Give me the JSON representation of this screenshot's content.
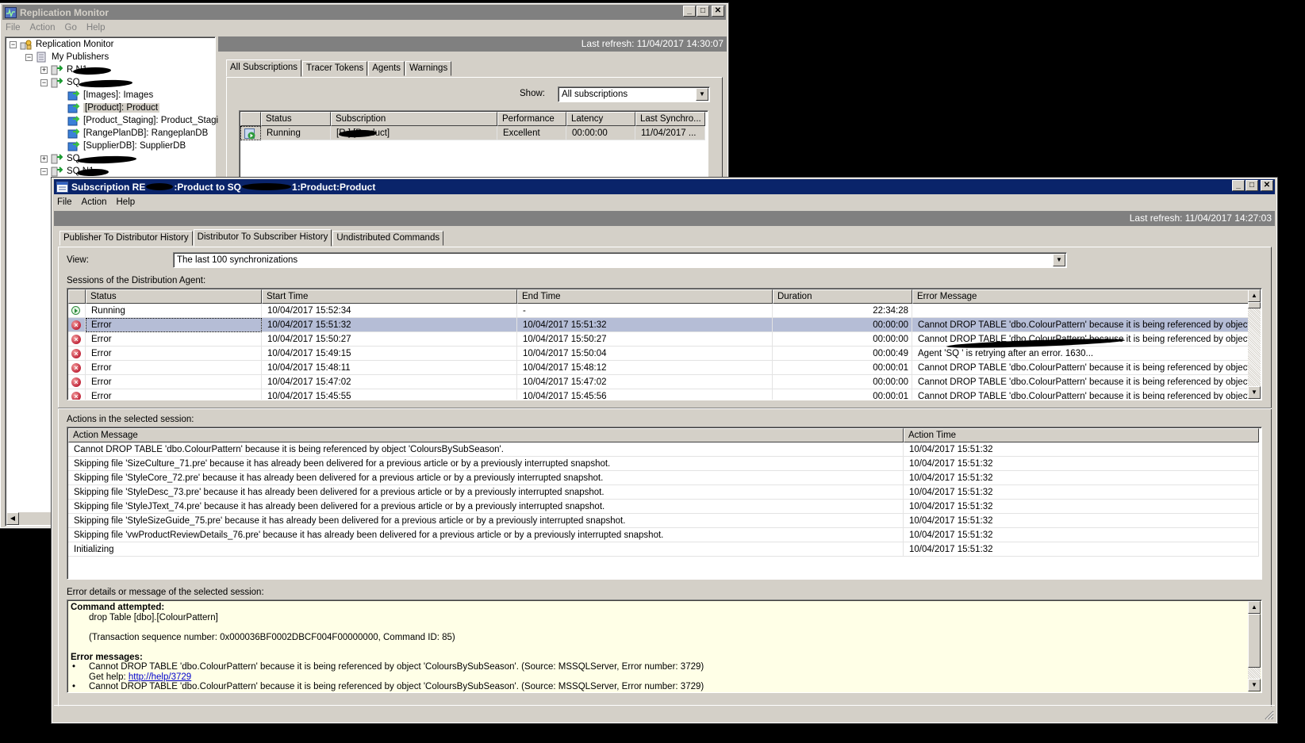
{
  "desktop": {
    "corner_text": "..."
  },
  "monitor_window": {
    "title": "Replication Monitor",
    "menu": [
      "File",
      "Action",
      "Go",
      "Help"
    ],
    "last_refresh": "Last refresh: 11/04/2017 14:30:07",
    "tree": {
      "root": "Replication Monitor",
      "publishers_group": "My Publishers",
      "publishers": [
        {
          "label": "R      N1",
          "expanded": false
        },
        {
          "label": "SQ",
          "expanded": true,
          "publications": [
            "[Images]: Images",
            "[Product]: Product",
            "[Product_Staging]: Product_Staging",
            "[RangePlanDB]: RangeplanDB",
            "[SupplierDB]: SupplierDB"
          ]
        },
        {
          "label": "SQ",
          "expanded": false
        },
        {
          "label": "SQ       N1",
          "expanded": true
        }
      ],
      "selected": "[Product]: Product"
    },
    "tabs": [
      "All Subscriptions",
      "Tracer Tokens",
      "Agents",
      "Warnings"
    ],
    "active_tab": "All Subscriptions",
    "show_label": "Show:",
    "show_value": "All subscriptions",
    "grid": {
      "columns": [
        "",
        "Status",
        "Subscription",
        "Performance",
        "Latency",
        "Last Synchro..."
      ],
      "rows": [
        {
          "status": "Running",
          "subscription": "[R        ].[Product]",
          "performance": "Excellent",
          "latency": "00:00:00",
          "last_sync": "11/04/2017 ..."
        }
      ]
    }
  },
  "subscription_window": {
    "title_parts": [
      "Subscription RE",
      ":Product to SQ",
      "1:Product:Product"
    ],
    "menu": [
      "File",
      "Action",
      "Help"
    ],
    "last_refresh": "Last refresh: 11/04/2017 14:27:03",
    "tabs": [
      "Publisher To Distributor History",
      "Distributor To Subscriber History",
      "Undistributed Commands"
    ],
    "active_tab": "Distributor To Subscriber History",
    "view_label": "View:",
    "view_value": "The last 100 synchronizations",
    "sessions_label": "Sessions of the Distribution Agent:",
    "sessions": {
      "columns": [
        "",
        "Status",
        "Start Time",
        "End Time",
        "Duration",
        "Error Message"
      ],
      "rows": [
        {
          "icon": "running",
          "status": "Running",
          "start": "10/04/2017 15:52:34",
          "end": "-",
          "duration": "22:34:28",
          "message": ""
        },
        {
          "icon": "error",
          "status": "Error",
          "start": "10/04/2017 15:51:32",
          "end": "10/04/2017 15:51:32",
          "duration": "00:00:00",
          "message": "Cannot DROP TABLE 'dbo.ColourPattern' because it is being referenced by object 'C...",
          "selected": true
        },
        {
          "icon": "error",
          "status": "Error",
          "start": "10/04/2017 15:50:27",
          "end": "10/04/2017 15:50:27",
          "duration": "00:00:00",
          "message": "Cannot DROP TABLE 'dbo.ColourPattern' because it is being referenced by object 'C..."
        },
        {
          "icon": "error",
          "status": "Error",
          "start": "10/04/2017 15:49:15",
          "end": "10/04/2017 15:50:04",
          "duration": "00:00:49",
          "message": "Agent 'SQ                                   ' is retrying after an error. 1630..."
        },
        {
          "icon": "error",
          "status": "Error",
          "start": "10/04/2017 15:48:11",
          "end": "10/04/2017 15:48:12",
          "duration": "00:00:01",
          "message": "Cannot DROP TABLE 'dbo.ColourPattern' because it is being referenced by object 'C..."
        },
        {
          "icon": "error",
          "status": "Error",
          "start": "10/04/2017 15:47:02",
          "end": "10/04/2017 15:47:02",
          "duration": "00:00:00",
          "message": "Cannot DROP TABLE 'dbo.ColourPattern' because it is being referenced by object 'C..."
        },
        {
          "icon": "error",
          "status": "Error",
          "start": "10/04/2017 15:45:55",
          "end": "10/04/2017 15:45:56",
          "duration": "00:00:01",
          "message": "Cannot DROP TABLE 'dbo.ColourPattern' because it is being referenced by object 'C..."
        }
      ]
    },
    "actions_label": "Actions in the selected session:",
    "actions": {
      "columns": [
        "Action Message",
        "Action Time"
      ],
      "rows": [
        {
          "message": "Cannot DROP TABLE 'dbo.ColourPattern' because it is being referenced by object 'ColoursBySubSeason'.",
          "time": "10/04/2017 15:51:32"
        },
        {
          "message": "Skipping file 'SizeCulture_71.pre' because it has already been delivered for a previous article or by a previously interrupted snapshot.",
          "time": "10/04/2017 15:51:32"
        },
        {
          "message": "Skipping file 'StyleCore_72.pre' because it has already been delivered for a previous article or by a previously interrupted snapshot.",
          "time": "10/04/2017 15:51:32"
        },
        {
          "message": "Skipping file 'StyleDesc_73.pre' because it has already been delivered for a previous article or by a previously interrupted snapshot.",
          "time": "10/04/2017 15:51:32"
        },
        {
          "message": "Skipping file 'StyleJText_74.pre' because it has already been delivered for a previous article or by a previously interrupted snapshot.",
          "time": "10/04/2017 15:51:32"
        },
        {
          "message": "Skipping file 'StyleSizeGuide_75.pre' because it has already been delivered for a previous article or by a previously interrupted snapshot.",
          "time": "10/04/2017 15:51:32"
        },
        {
          "message": "Skipping file 'vwProductReviewDetails_76.pre' because it has already been delivered for a previous article or by a previously interrupted snapshot.",
          "time": "10/04/2017 15:51:32"
        },
        {
          "message": "Initializing",
          "time": "10/04/2017 15:51:32"
        }
      ]
    },
    "error_label": "Error details or message of the selected session:",
    "error_details": {
      "command_heading": "Command attempted:",
      "command": "drop Table [dbo].[ColourPattern]",
      "transaction": "(Transaction sequence number: 0x000036BF0002DBCF004F00000000, Command ID: 85)",
      "errors_heading": "Error messages:",
      "messages": [
        {
          "text": "Cannot DROP TABLE 'dbo.ColourPattern' because it is being referenced by object 'ColoursBySubSeason'. (Source: MSSQLServer, Error number: 3729)",
          "help_prefix": "Get help: ",
          "help_link": "http://help/3729"
        },
        {
          "text": "Cannot DROP TABLE 'dbo.ColourPattern' because it is being referenced by object 'ColoursBySubSeason'. (Source: MSSQLServer, Error number: 3729)"
        }
      ]
    }
  },
  "colors": {
    "active_title": "#0a246a",
    "inactive_title": "#808080",
    "face": "#d4d0c8",
    "selection": "#b5bdd6",
    "error_bg": "#ffffe7"
  }
}
